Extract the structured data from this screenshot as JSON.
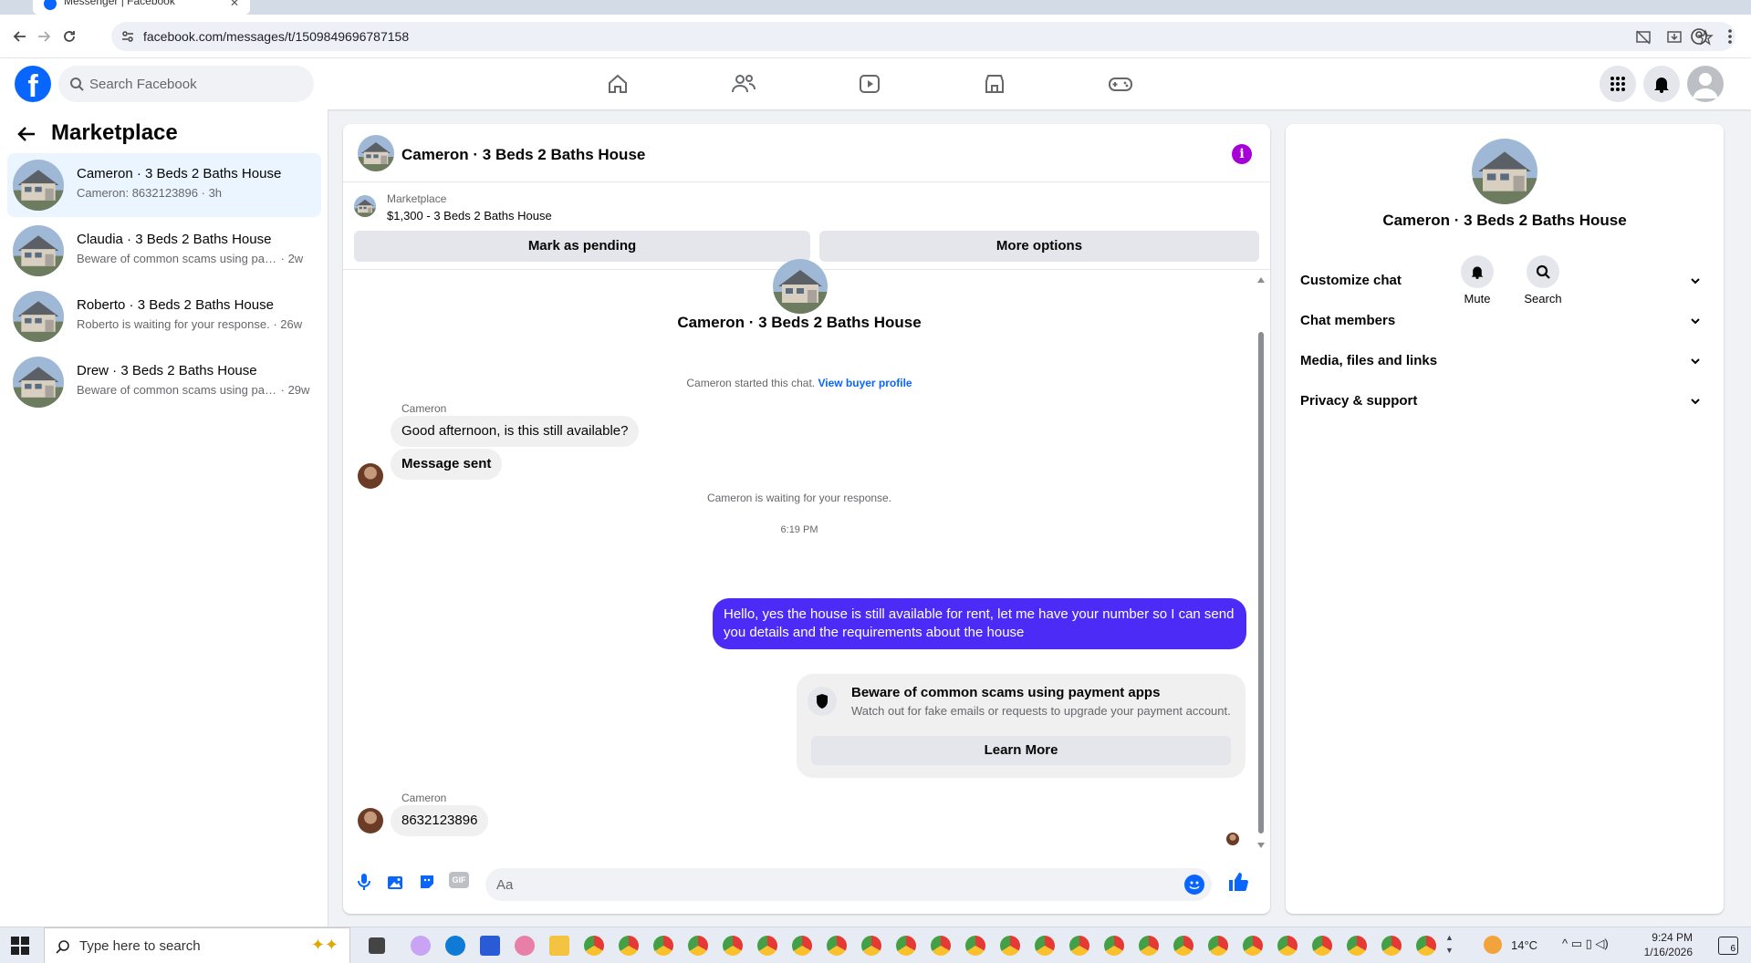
{
  "browser": {
    "tab_title": "Messenger | Facebook",
    "url": "facebook.com/messages/t/1509849696787158"
  },
  "fb_header": {
    "search_placeholder": "Search Facebook"
  },
  "left_panel": {
    "title": "Marketplace",
    "conversations": [
      {
        "name": "Cameron · 3 Beds 2 Baths House",
        "preview": "Cameron: 8632123896",
        "time": "· 3h",
        "active": true
      },
      {
        "name": "Claudia · 3 Beds 2 Baths House",
        "preview": "Beware of common scams using pay...",
        "time": "· 2w",
        "active": false
      },
      {
        "name": "Roberto · 3 Beds 2 Baths House",
        "preview": "Roberto is waiting for your response.",
        "time": "· 26w",
        "active": false
      },
      {
        "name": "Drew · 3 Beds 2 Baths House",
        "preview": "Beware of common scams using pay...",
        "time": "· 29w",
        "active": false
      }
    ]
  },
  "chat": {
    "title": "Cameron · 3 Beds 2 Baths House",
    "listing_kicker": "Marketplace",
    "listing_title": "$1,300 - 3 Beds 2 Baths House",
    "mark_pending": "Mark as pending",
    "more_options": "More options",
    "intro_name": "Cameron · 3 Beds 2 Baths House",
    "started_text": "Cameron started this chat.",
    "buyer_profile_link": "View buyer profile",
    "sender_name": "Cameron",
    "msg1": "Good afternoon, is this still available?",
    "msg2": "Message sent",
    "waiting_text": "Cameron is waiting for your response.",
    "timestamp": "6:19 PM",
    "outgoing": "Hello, yes the house is still available for rent, let me have your number so I can send you details and the requirements about the house",
    "warning_title": "Beware of common scams using payment apps",
    "warning_body": "Watch out for fake emails or requests to upgrade your payment account.",
    "learn_more": "Learn More",
    "sender_name_2": "Cameron",
    "msg3": "8632123896",
    "composer_placeholder": "Aa",
    "gif_label": "GIF"
  },
  "right_panel": {
    "name": "Cameron · 3 Beds 2 Baths House",
    "mute_label": "Mute",
    "search_label": "Search",
    "sections": [
      "Customize chat",
      "Chat members",
      "Media, files and links",
      "Privacy & support"
    ]
  },
  "taskbar": {
    "search_placeholder": "Type here to search",
    "temperature": "14°C",
    "time": "9:24 PM",
    "date": "1/16/2026",
    "notification_count": "6"
  },
  "colors": {
    "fb_blue": "#0866ff",
    "outgoing_bubble": "#4b2bf5",
    "info_purple": "#a700d6"
  }
}
